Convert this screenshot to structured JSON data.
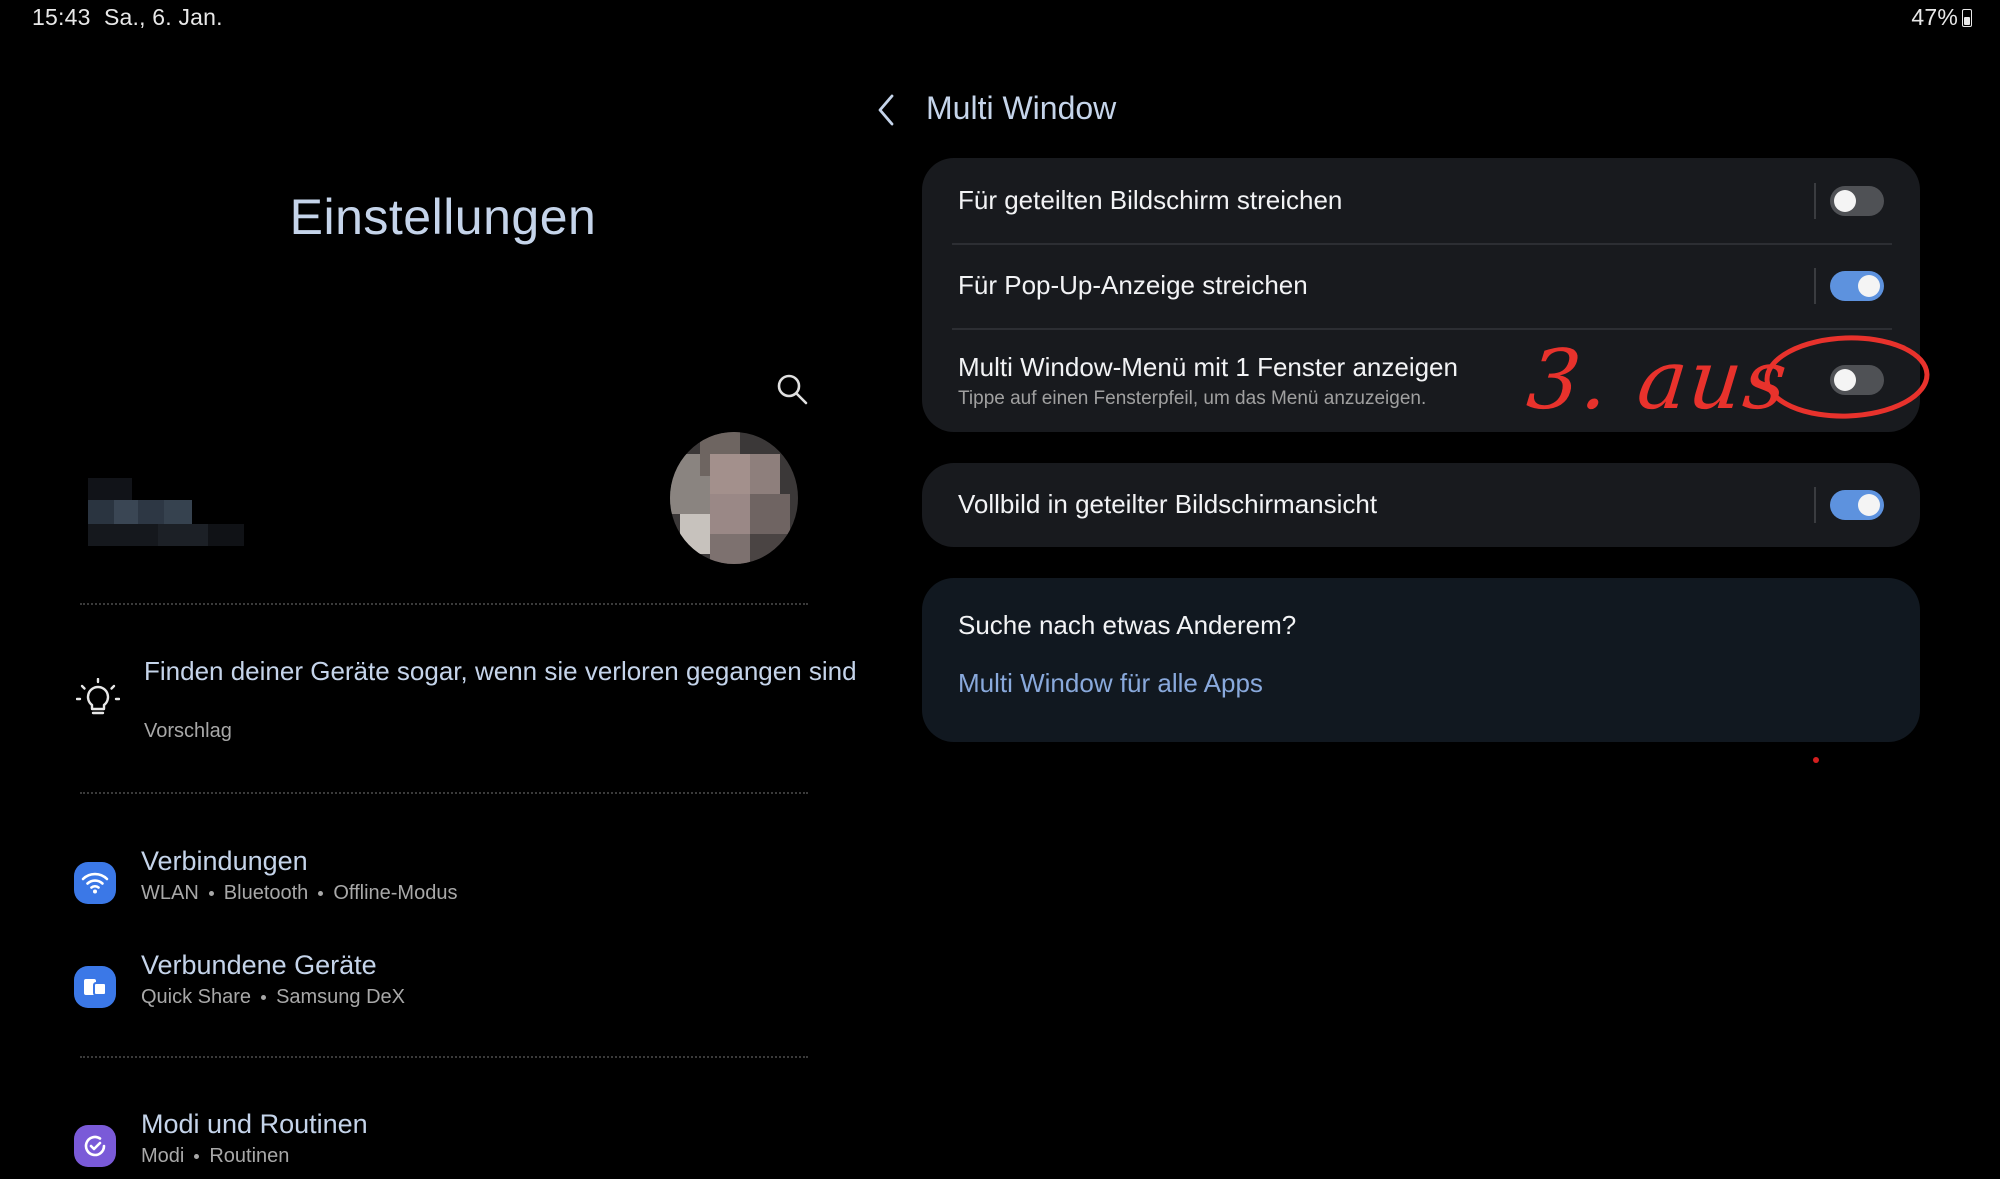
{
  "status_bar": {
    "time": "15:43",
    "date": "Sa., 6. Jan.",
    "battery": "47%"
  },
  "left_pane": {
    "title": "Einstellungen",
    "search_icon": "search-icon",
    "suggestion": {
      "icon": "lightbulb-icon",
      "title": "Finden deiner Geräte sogar, wenn sie verloren gegangen sind",
      "subtitle": "Vorschlag"
    },
    "items": [
      {
        "title": "Verbindungen",
        "subs": [
          "WLAN",
          "Bluetooth",
          "Offline-Modus"
        ],
        "icon": "wifi-icon",
        "icon_color": "#3b78e7"
      },
      {
        "title": "Verbundene Geräte",
        "subs": [
          "Quick Share",
          "Samsung DeX"
        ],
        "icon": "connected-devices-icon",
        "icon_color": "#3b78e7"
      },
      {
        "title": "Modi und Routinen",
        "subs": [
          "Modi",
          "Routinen"
        ],
        "icon": "routines-icon",
        "icon_color": "#7a5ad8"
      }
    ]
  },
  "right_pane": {
    "title": "Multi Window",
    "settings": [
      {
        "label": "Für geteilten Bildschirm streichen",
        "state": "off"
      },
      {
        "label": "Für Pop-Up-Anzeige streichen",
        "state": "on"
      },
      {
        "label": "Multi Window-Menü mit 1 Fenster anzeigen",
        "sublabel": "Tippe auf einen Fensterpfeil, um das Menü anzuzeigen.",
        "state": "off"
      },
      {
        "label": "Vollbild in geteilter Bildschirmansicht",
        "state": "on"
      }
    ],
    "search_card": {
      "title": "Suche nach etwas Anderem?",
      "link": "Multi Window für alle Apps"
    }
  },
  "annotation": {
    "text": "3. aus",
    "color": "#e8322c"
  },
  "colors": {
    "toggle_on": "#5d92de",
    "toggle_off": "#4f5155",
    "card_bg": "#181a1e",
    "accent_text": "#c5d4ea"
  }
}
